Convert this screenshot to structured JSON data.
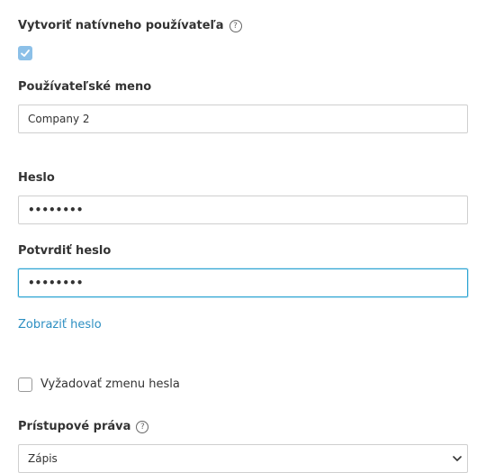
{
  "native_user": {
    "label": "Vytvoriť natívneho používateľa",
    "help_icon": "question-circle-icon",
    "checked": true
  },
  "username": {
    "label": "Používateľské meno",
    "value": "Company 2"
  },
  "password": {
    "label": "Heslo",
    "value": "••••••••"
  },
  "confirm_password": {
    "label": "Potvrdiť heslo",
    "value": "••••••••"
  },
  "show_password_link": "Zobraziť heslo",
  "require_change": {
    "label": "Vyžadovať zmenu hesla",
    "checked": false
  },
  "access_rights": {
    "label": "Prístupové práva",
    "help_icon": "question-circle-icon",
    "selected": "Zápis"
  },
  "colors": {
    "accent": "#2d8fc2",
    "focus_border": "#2da4d3",
    "checkbox_checked": "#8cc0e8"
  }
}
